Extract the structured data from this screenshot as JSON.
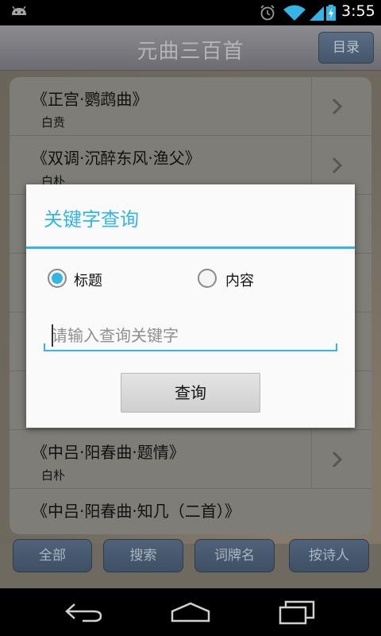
{
  "status_bar": {
    "time": "3:55",
    "icons": [
      "android-icon",
      "alarm-icon",
      "wifi-icon",
      "signal-icon",
      "battery-charging-icon"
    ]
  },
  "title_bar": {
    "title": "元曲三百首",
    "menu_button": "目录"
  },
  "list": {
    "rows": [
      {
        "title": "《正宫·鹦鹉曲》",
        "author": "白贲"
      },
      {
        "title": "《双调·沉醉东风·渔父》",
        "author": "白朴"
      },
      {
        "title": "《中吕·阳春曲·题情》",
        "author": "白朴"
      },
      {
        "title": "《中吕·阳春曲·知几（二首）》",
        "author": ""
      }
    ]
  },
  "dialog": {
    "title": "关键字查询",
    "radio_title": "标题",
    "radio_content": "内容",
    "selected": "标题",
    "input_placeholder": "请输入查询关键字",
    "input_value": "",
    "query_button": "查询"
  },
  "bottom_buttons": [
    "全部",
    "搜索",
    "词牌名",
    "按诗人"
  ],
  "nav_bar": {
    "icons": [
      "back-icon",
      "home-icon",
      "recent-apps-icon"
    ]
  },
  "colors": {
    "accent": "#33b5e5",
    "title_text": "#b4b3b8",
    "button_bg": "#4a5b70"
  }
}
